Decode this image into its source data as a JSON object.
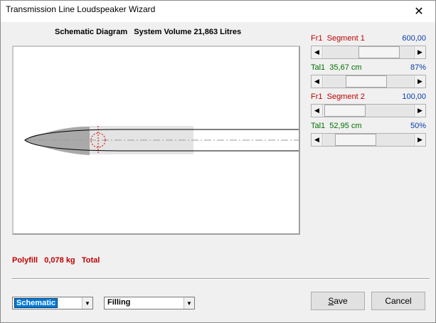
{
  "window": {
    "title": "Transmission Line Loudspeaker Wizard",
    "close_glyph": "✕"
  },
  "diagram": {
    "caption_label": "Schematic Diagram",
    "volume_label": "System Volume 21,863 Litres"
  },
  "controls": [
    {
      "label": "Fr1  Segment 1",
      "value": "600,00",
      "label_color": "#c00000",
      "slider_fraction": 0.72
    },
    {
      "label": "Tal1  35,67 cm",
      "value": "87%",
      "label_color": "#007000",
      "slider_fraction": 0.46
    },
    {
      "label": "Fr1  Segment 2",
      "value": "100,00",
      "label_color": "#c00000",
      "slider_fraction": 0.02
    },
    {
      "label": "Tal1  52,95 cm",
      "value": "50%",
      "label_color": "#007000",
      "slider_fraction": 0.24
    }
  ],
  "polyfill": {
    "label": "Polyfill",
    "amount": "0,078 kg",
    "suffix": "Total"
  },
  "view_select": {
    "value": "Schematic",
    "arrow_glyph": "▼"
  },
  "mode_select": {
    "value": "Filling",
    "arrow_glyph": "▼"
  },
  "buttons": {
    "save_prefix": "S",
    "save_rest": "ave",
    "cancel": "Cancel"
  },
  "scroll_arrows": {
    "left": "◀",
    "right": "▶"
  },
  "colors": {
    "segment_filled": "#a9a9a9",
    "segment_light": "#e4e4e4",
    "driver_marker": "#d00000",
    "center_line": "#9a9a9a"
  }
}
